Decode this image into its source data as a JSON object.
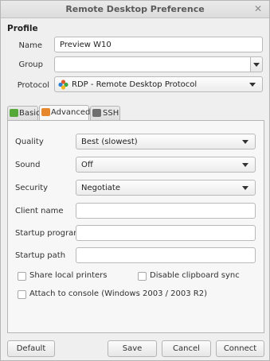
{
  "window": {
    "title": "Remote Desktop Preference"
  },
  "profile": {
    "section_title": "Profile",
    "name_label": "Name",
    "name_value": "Preview W10",
    "group_label": "Group",
    "group_value": "",
    "protocol_label": "Protocol",
    "protocol_value": "RDP - Remote Desktop Protocol"
  },
  "tabs": [
    {
      "label": "Basic",
      "active": false
    },
    {
      "label": "Advanced",
      "active": true
    },
    {
      "label": "SSH",
      "active": false
    }
  ],
  "advanced": {
    "quality_label": "Quality",
    "quality_value": "Best (slowest)",
    "sound_label": "Sound",
    "sound_value": "Off",
    "security_label": "Security",
    "security_value": "Negotiate",
    "client_name_label": "Client name",
    "client_name_value": "",
    "startup_program_label": "Startup program",
    "startup_program_value": "",
    "startup_path_label": "Startup path",
    "startup_path_value": "",
    "share_printers_label": "Share local printers",
    "share_printers_checked": false,
    "disable_clipboard_label": "Disable clipboard sync",
    "disable_clipboard_checked": false,
    "attach_console_label": "Attach to console (Windows 2003 / 2003 R2)",
    "attach_console_checked": false
  },
  "buttons": {
    "default_label": "Default",
    "save_label": "Save",
    "cancel_label": "Cancel",
    "connect_label": "Connect"
  },
  "icons": {
    "close": "close-icon",
    "protocol": "rdp-protocol-icon",
    "tab_basic": "basic-tab-icon",
    "tab_advanced": "advanced-tab-icon",
    "tab_ssh": "ssh-tab-icon"
  }
}
